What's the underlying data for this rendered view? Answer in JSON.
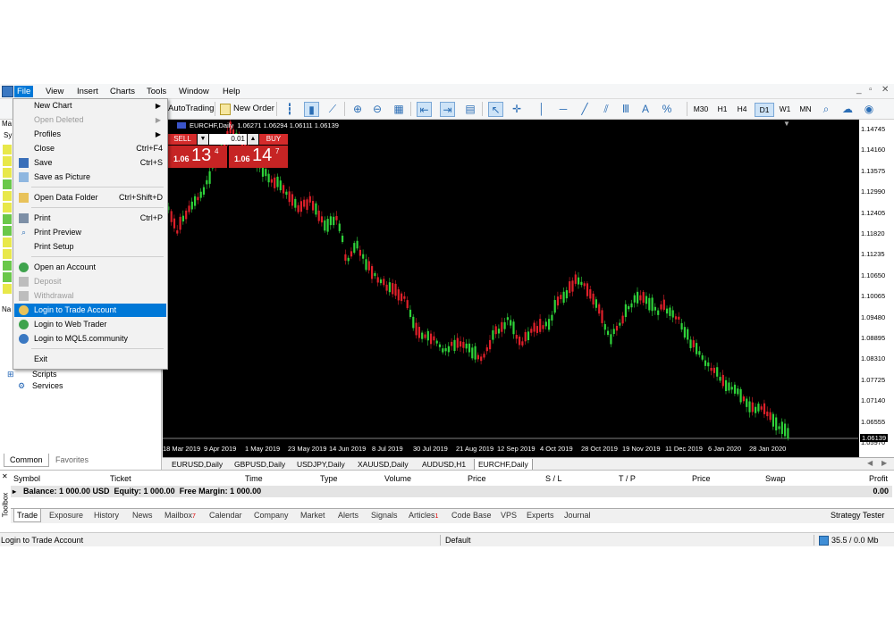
{
  "menu": [
    "File",
    "View",
    "Insert",
    "Charts",
    "Tools",
    "Window",
    "Help"
  ],
  "toolbar": {
    "autotrading": "AutoTrading",
    "new_order": "New Order",
    "timeframes": [
      "M30",
      "H1",
      "H4",
      "D1",
      "W1",
      "MN"
    ],
    "active_timeframe": "D1"
  },
  "file_menu": [
    {
      "label": "New Chart",
      "shortcut": "",
      "submenu": true,
      "disabled": false
    },
    {
      "label": "Open Deleted",
      "shortcut": "",
      "submenu": true,
      "disabled": true
    },
    {
      "label": "Profiles",
      "shortcut": "",
      "submenu": true,
      "disabled": false
    },
    {
      "label": "Close",
      "shortcut": "Ctrl+F4",
      "disabled": false
    },
    {
      "label": "Save",
      "shortcut": "Ctrl+S",
      "disabled": false
    },
    {
      "label": "Save as Picture",
      "shortcut": "",
      "disabled": false
    },
    {
      "label": "Open Data Folder",
      "shortcut": "Ctrl+Shift+D",
      "disabled": false
    },
    {
      "label": "Print",
      "shortcut": "Ctrl+P",
      "disabled": false
    },
    {
      "label": "Print Preview",
      "shortcut": "",
      "disabled": false
    },
    {
      "label": "Print Setup",
      "shortcut": "",
      "disabled": false
    },
    {
      "label": "Open an Account",
      "shortcut": "",
      "disabled": false
    },
    {
      "label": "Deposit",
      "shortcut": "",
      "disabled": true
    },
    {
      "label": "Withdrawal",
      "shortcut": "",
      "disabled": true
    },
    {
      "label": "Login to Trade Account",
      "shortcut": "",
      "disabled": false,
      "highlighted": true
    },
    {
      "label": "Login to Web Trader",
      "shortcut": "",
      "disabled": false
    },
    {
      "label": "Login to MQL5.community",
      "shortcut": "",
      "disabled": false
    },
    {
      "label": "Exit",
      "shortcut": "",
      "disabled": false
    }
  ],
  "navigator": {
    "items": [
      "Scripts",
      "Services"
    ],
    "tabs": [
      "Common",
      "Favorites"
    ],
    "active_tab": "Common"
  },
  "chart": {
    "header": "EURCHF,Daily  1.06271 1.06294 1.06111 1.06139",
    "sell_label": "SELL",
    "buy_label": "BUY",
    "lot": "0.01",
    "sell_big": "13",
    "sell_small": "1.06",
    "sell_sup": "4",
    "buy_big": "14",
    "buy_small": "1.06",
    "buy_sup": "7",
    "price_tag": "1.06139",
    "y_labels": [
      "1.14745",
      "1.14160",
      "1.13575",
      "1.12990",
      "1.12405",
      "1.11820",
      "1.11235",
      "1.10650",
      "1.10065",
      "1.09480",
      "1.08895",
      "1.08310",
      "1.07725",
      "1.07140",
      "1.06555",
      "1.05970"
    ],
    "x_labels": [
      "18 Mar 2019",
      "9 Apr 2019",
      "1 May 2019",
      "23 May 2019",
      "14 Jun 2019",
      "8 Jul 2019",
      "30 Jul 2019",
      "21 Aug 2019",
      "12 Sep 2019",
      "4 Oct 2019",
      "28 Oct 2019",
      "19 Nov 2019",
      "11 Dec 2019",
      "6 Jan 2020",
      "28 Jan 2020"
    ]
  },
  "chart_tabs": [
    "EURUSD,Daily",
    "GBPUSD,Daily",
    "USDJPY,Daily",
    "XAUUSD,Daily",
    "AUDUSD,H1",
    "EURCHF,Daily"
  ],
  "active_chart_tab": "EURCHF,Daily",
  "terminal": {
    "headers": [
      "Symbol",
      "Ticket",
      "Time",
      "Type",
      "Volume",
      "Price",
      "S / L",
      "T / P",
      "Price",
      "Swap",
      "Profit"
    ],
    "balance_line": "Balance: 1 000.00 USD  Equity: 1 000.00  Free Margin: 1 000.00",
    "profit": "0.00",
    "tabs": [
      "Trade",
      "Exposure",
      "History",
      "News",
      "Mailbox",
      "Calendar",
      "Company",
      "Market",
      "Alerts",
      "Signals",
      "Articles",
      "Code Base",
      "VPS",
      "Experts",
      "Journal"
    ],
    "mailbox_count": "7",
    "articles_count": "1",
    "strategy_tester": "Strategy Tester",
    "toolbox_label": "Toolbox"
  },
  "status": {
    "left": "Login to Trade Account",
    "profile": "Default",
    "traffic": "35.5 / 0.0 Mb"
  }
}
